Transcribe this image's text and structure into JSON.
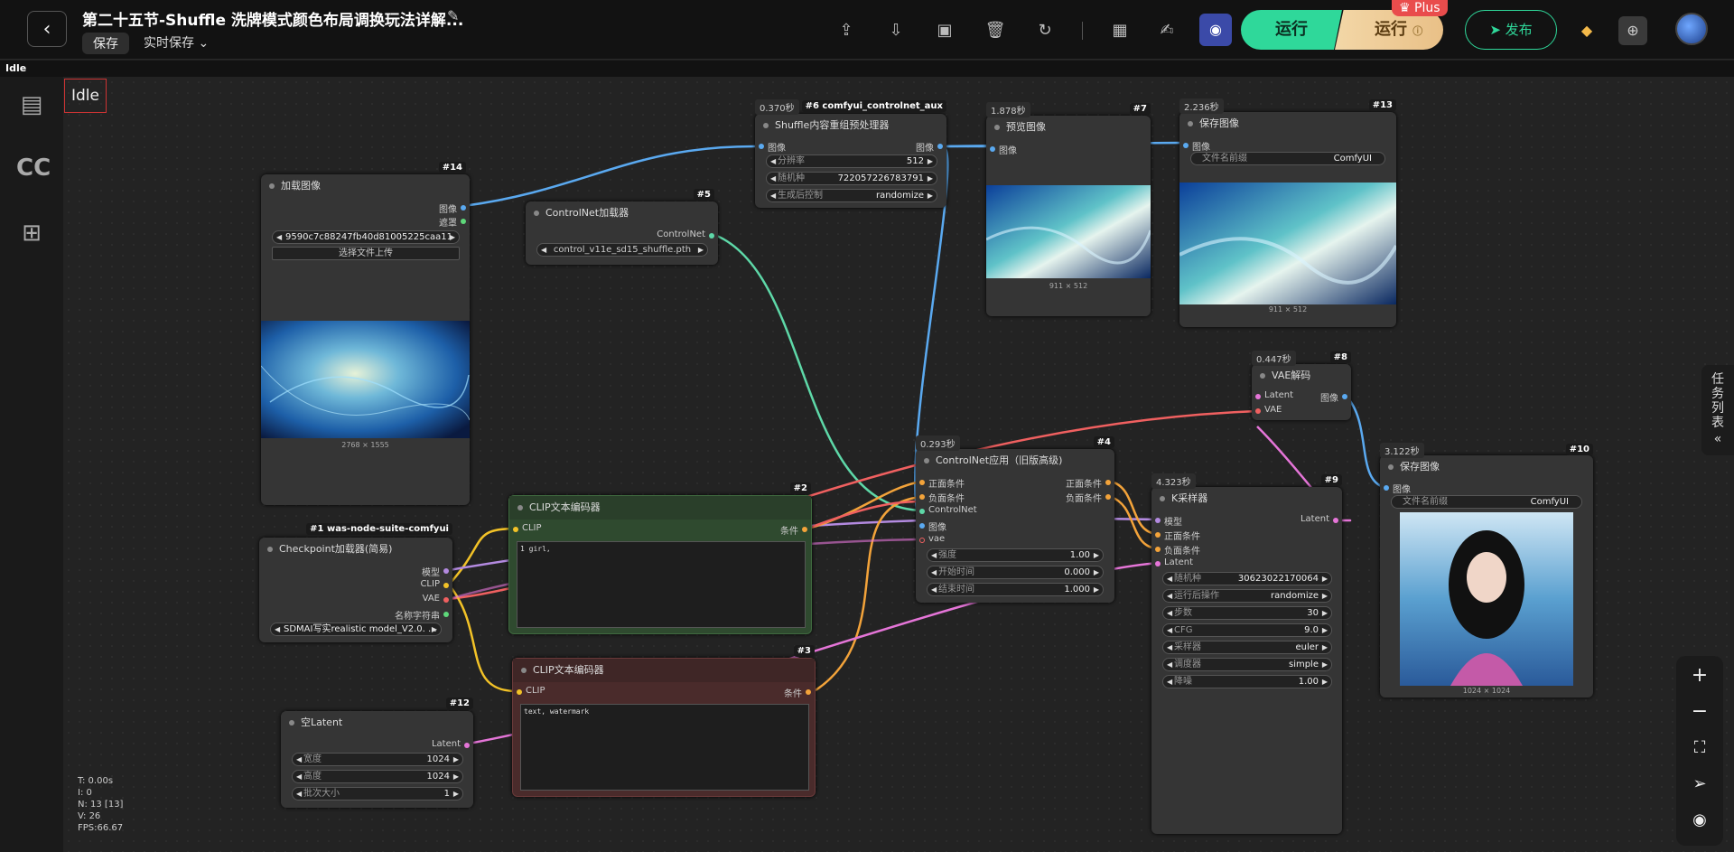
{
  "header": {
    "back_icon": "chevron-left-icon",
    "title": "第二十五节-Shuffle 洗牌模式颜色布局调换玩法详解...",
    "save_label": "保存",
    "realtime_label": "实时保存",
    "run_label": "运行",
    "run_plus_label": "运行",
    "plus_badge": "Plus",
    "publish_label": "发布",
    "icons": [
      "upload-icon",
      "download-icon",
      "clipboard-icon",
      "trash-icon",
      "refresh-icon",
      "grid-icon",
      "edit-icon",
      "discord-icon"
    ]
  },
  "status_bar": {
    "text": "Idle"
  },
  "canvas_status": {
    "text": "Idle"
  },
  "sidebar": {
    "items": [
      "notebook-icon",
      "cc-logo-icon",
      "hierarchy-icon"
    ]
  },
  "queue_tab": {
    "label": "任务列表",
    "collapse": "«"
  },
  "stats": {
    "t": "T: 0.00s",
    "i": "I: 0",
    "n": "N: 13 [13]",
    "v": "V: 26",
    "fps": "FPS:66.67"
  },
  "nodes": {
    "n14": {
      "id": "#14",
      "title": "加载图像",
      "out1": "图像",
      "out2": "遮罩",
      "file": "9590c7c88247fb40d81005225caa11 ...",
      "upload": "选择文件上传",
      "caption": "2768 × 1555"
    },
    "n5": {
      "id": "#5",
      "title": "ControlNet加载器",
      "out": "ControlNet",
      "model": "control_v11e_sd15_shuffle.pth"
    },
    "n6": {
      "id": "#6 comfyui_controlnet_aux",
      "time": "0.370秒",
      "title": "Shuffle内容重组预处理器",
      "in": "图像",
      "out": "图像",
      "w1l": "分辨率",
      "w1v": "512",
      "w2l": "随机种",
      "w2v": "722057226783791",
      "w3l": "生成后控制",
      "w3v": "randomize"
    },
    "n7": {
      "id": "#7",
      "time": "1.878秒",
      "title": "预览图像",
      "in": "图像",
      "caption": "911 × 512"
    },
    "n13": {
      "id": "#13",
      "time": "2.236秒",
      "title": "保存图像",
      "in": "图像",
      "wl": "文件名前缀",
      "wv": "ComfyUI",
      "caption": "911 × 512"
    },
    "n8": {
      "id": "#8",
      "time": "0.447秒",
      "title": "VAE解码",
      "in1": "Latent",
      "in2": "VAE",
      "out": "图像"
    },
    "n10": {
      "id": "#10",
      "time": "3.122秒",
      "title": "保存图像",
      "in": "图像",
      "wl": "文件名前缀",
      "wv": "ComfyUI",
      "caption": "1024 × 1024"
    },
    "n4": {
      "id": "#4",
      "time": "0.293秒",
      "title": "ControlNet应用（旧版高级)",
      "in1": "正面条件",
      "in2": "负面条件",
      "in3": "ControlNet",
      "in4": "图像",
      "in5": "vae",
      "out1": "正面条件",
      "out2": "负面条件",
      "w1l": "强度",
      "w1v": "1.00",
      "w2l": "开始时间",
      "w2v": "0.000",
      "w3l": "结束时间",
      "w3v": "1.000"
    },
    "n9": {
      "id": "#9",
      "time": "4.323秒",
      "title": "K采样器",
      "in1": "模型",
      "in2": "正面条件",
      "in3": "负面条件",
      "in4": "Latent",
      "out": "Latent",
      "w1l": "随机种",
      "w1v": "306230221700​64",
      "w2l": "运行后操作",
      "w2v": "randomize",
      "w3l": "步数",
      "w3v": "30",
      "w4l": "CFG",
      "w4v": "9.0",
      "w5l": "采样器",
      "w5v": "euler",
      "w6l": "调度器",
      "w6v": "simple",
      "w7l": "降噪",
      "w7v": "1.00"
    },
    "n2": {
      "id": "#2",
      "title": "CLIP文本编码器",
      "in": "CLIP",
      "out": "条件",
      "text": "1 girl,"
    },
    "n1": {
      "id": "#1 was-node-suite-comfyui",
      "title": "Checkpoint加载器(简易)",
      "o1": "模型",
      "o2": "CLIP",
      "o3": "VAE",
      "o4": "名称字符串",
      "model": "SDMAI写实realistic model_V2.0. ..."
    },
    "n3": {
      "id": "#3",
      "title": "CLIP文本编码器",
      "in": "CLIP",
      "out": "条件",
      "text": "text, watermark"
    },
    "n12": {
      "id": "#12",
      "title": "空Latent",
      "out": "Latent",
      "w1l": "宽度",
      "w1v": "1024",
      "w2l": "高度",
      "w2v": "1024",
      "w3l": "批次大小",
      "w3v": "1"
    }
  },
  "colors": {
    "accent_green": "#2fd89a",
    "plus_red": "#e94c4c",
    "wire_blue": "#5aa9f0",
    "wire_yellow": "#f2c227",
    "wire_orange": "#f3a33a",
    "wire_pink": "#e575d8",
    "wire_red": "#f06060",
    "wire_teal": "#5ed8a8",
    "wire_purple": "#b38ae0"
  }
}
